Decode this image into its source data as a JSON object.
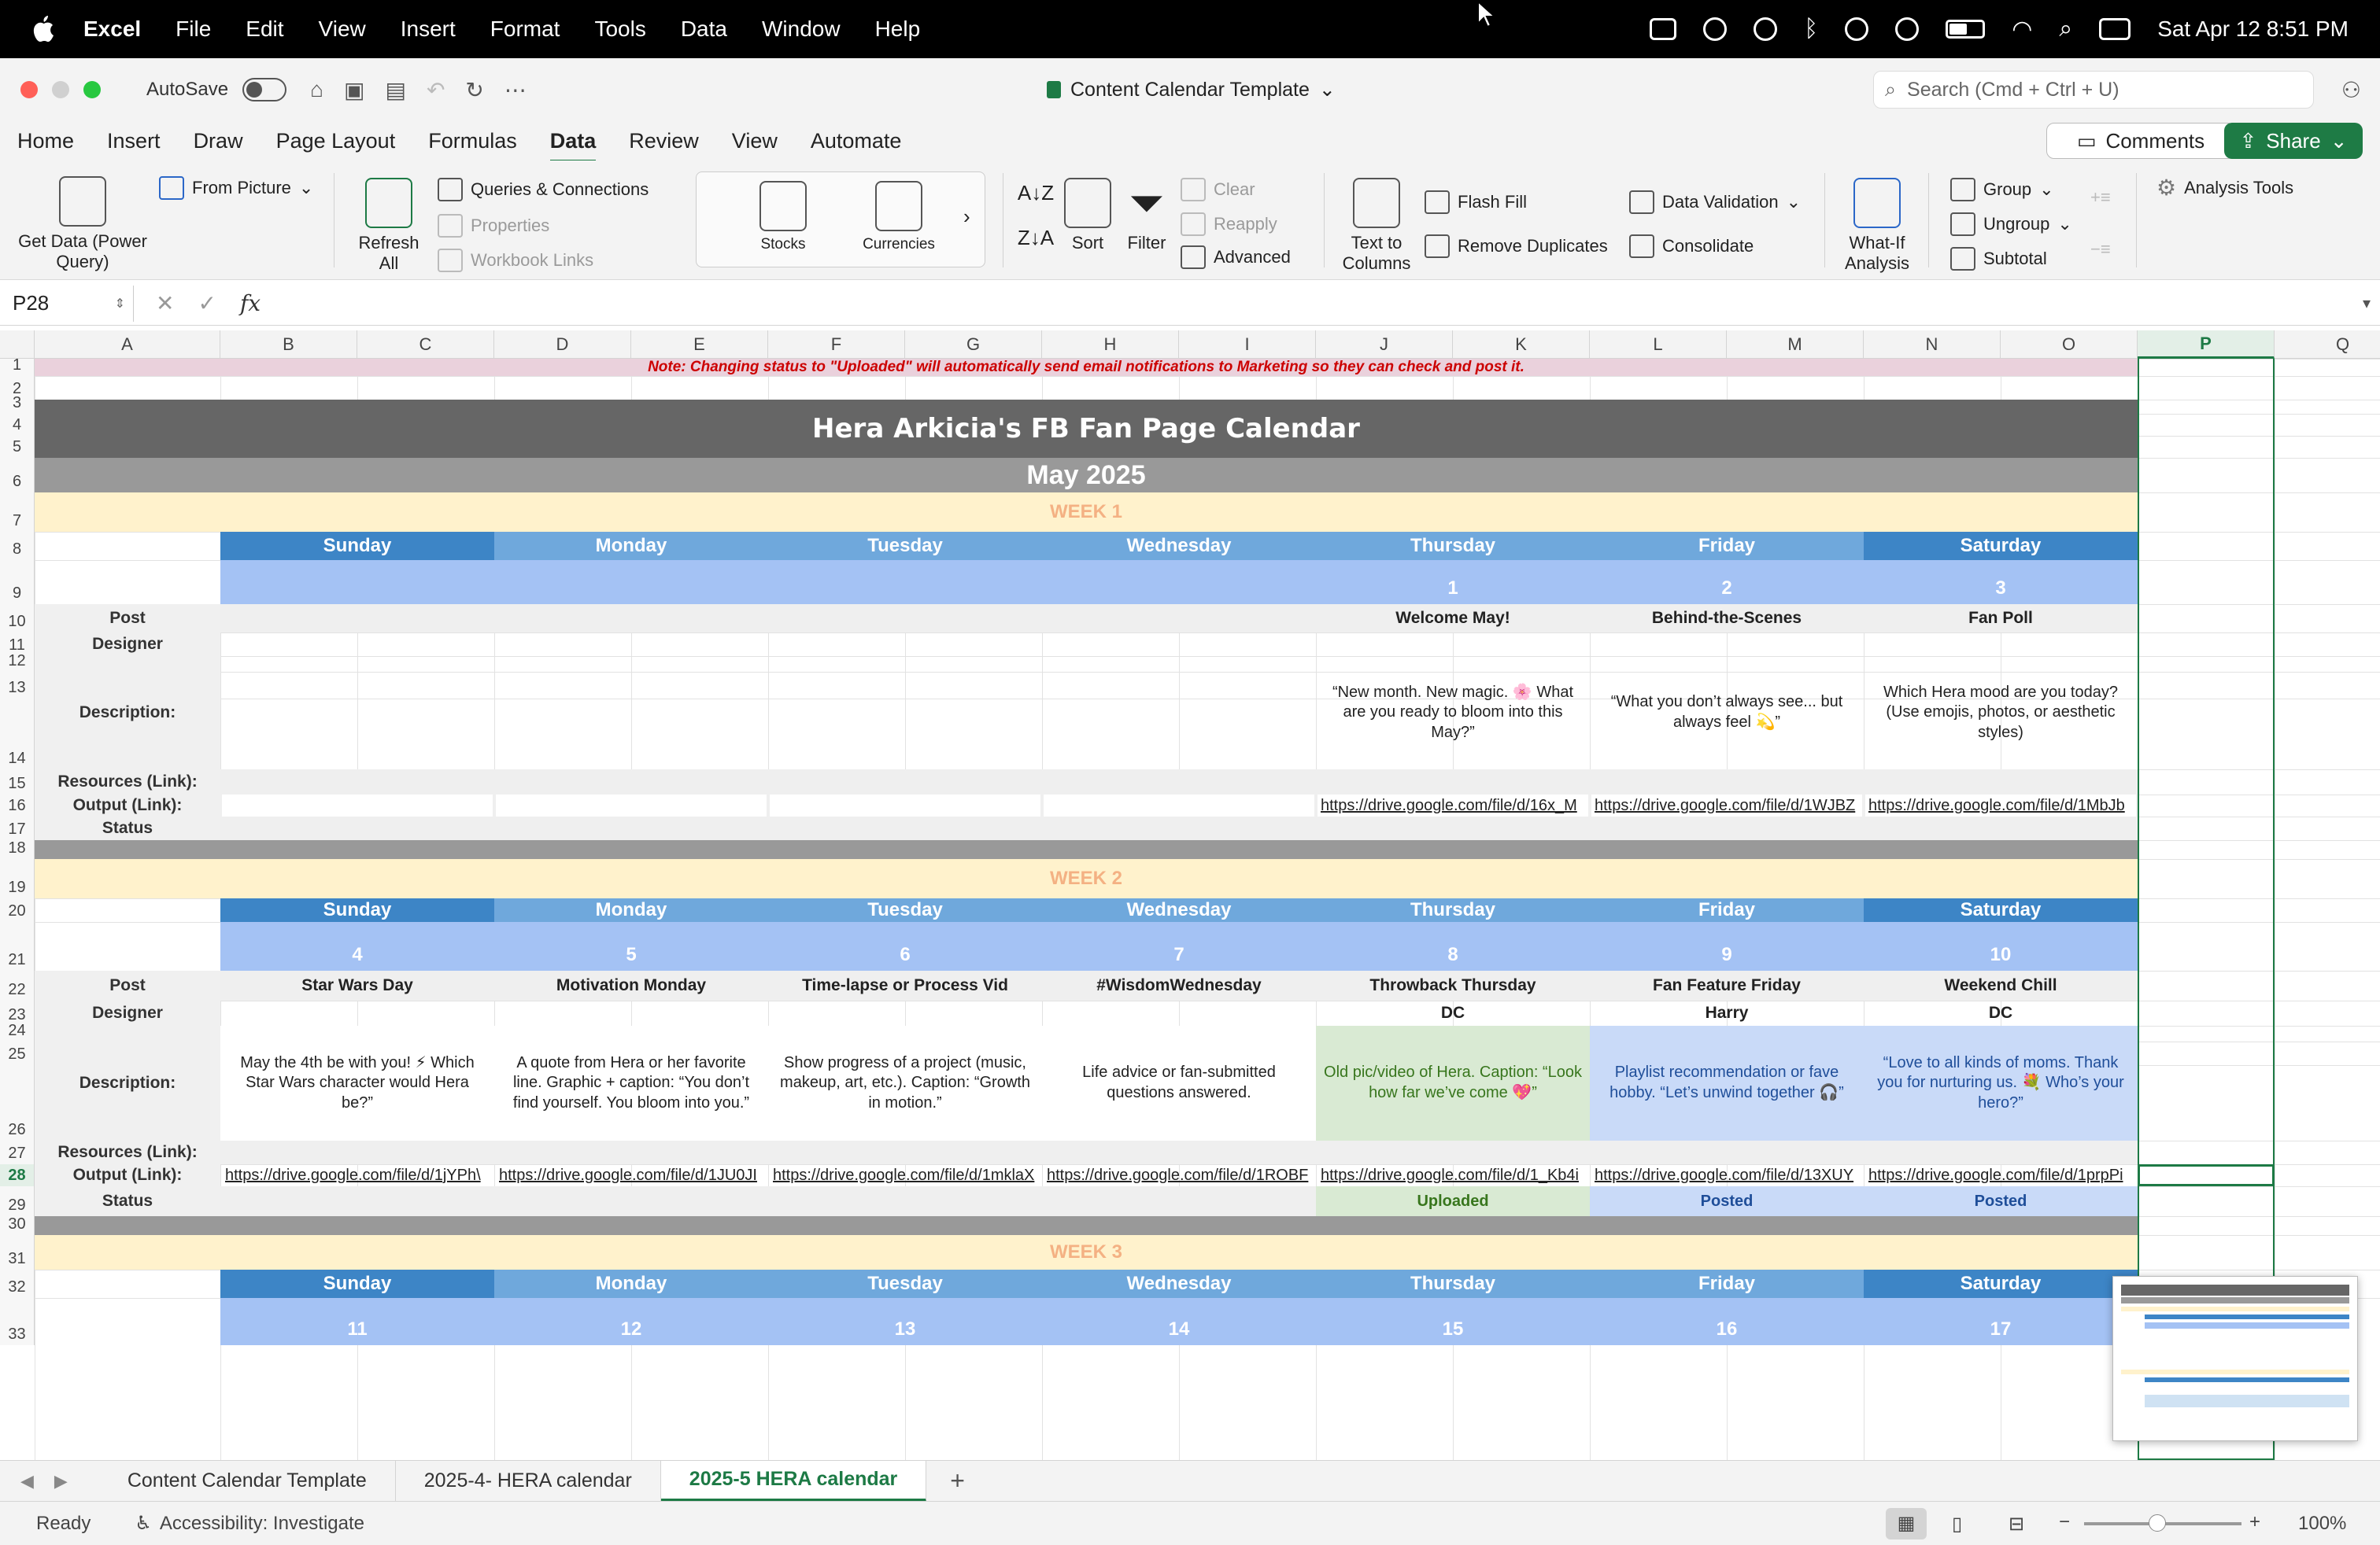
{
  "menubar": {
    "app": "Excel",
    "items": [
      "File",
      "Edit",
      "View",
      "Insert",
      "Format",
      "Tools",
      "Data",
      "Window",
      "Help"
    ],
    "clock": "Sat Apr 12  8:51 PM"
  },
  "titlebar": {
    "autosave_label": "AutoSave",
    "doc_title": "Content Calendar Template",
    "search_placeholder": "Search (Cmd + Ctrl + U)"
  },
  "ribbon_tabs": [
    "Home",
    "Insert",
    "Draw",
    "Page Layout",
    "Formulas",
    "Data",
    "Review",
    "View",
    "Automate"
  ],
  "ribbon_active_tab": "Data",
  "buttons": {
    "comments": "Comments",
    "share": "Share"
  },
  "ribbon": {
    "get_data": "Get Data (Power Query)",
    "from_picture": "From Picture",
    "refresh_all": "Refresh All",
    "queries": "Queries & Connections",
    "properties": "Properties",
    "workbook_links": "Workbook Links",
    "stocks": "Stocks",
    "currencies": "Currencies",
    "sort": "Sort",
    "filter": "Filter",
    "clear": "Clear",
    "reapply": "Reapply",
    "advanced": "Advanced",
    "text_to_columns": "Text to Columns",
    "flash_fill": "Flash Fill",
    "remove_duplicates": "Remove Duplicates",
    "data_validation": "Data Validation",
    "consolidate": "Consolidate",
    "what_if": "What-If Analysis",
    "group": "Group",
    "ungroup": "Ungroup",
    "subtotal": "Subtotal",
    "analysis_tools": "Analysis Tools"
  },
  "formula_bar": {
    "name_box": "P28",
    "fx": "fx",
    "formula": ""
  },
  "columns": [
    "A",
    "B",
    "C",
    "D",
    "E",
    "F",
    "G",
    "H",
    "I",
    "J",
    "K",
    "L",
    "M",
    "N",
    "O",
    "P",
    "Q"
  ],
  "selected_column": "P",
  "selected_row": "28",
  "sheet": {
    "note": "Note: Changing status to \"Uploaded\" will automatically send email notifications to Marketing so they can check and post it.",
    "title": "Hera Arkicia's FB Fan Page Calendar",
    "month": "May 2025",
    "days": [
      "Sunday",
      "Monday",
      "Tuesday",
      "Wednesday",
      "Thursday",
      "Friday",
      "Saturday"
    ],
    "labels": {
      "post": "Post",
      "designer": "Designer",
      "description": "Description:",
      "resources": "Resources (Link):",
      "output": "Output (Link):",
      "status": "Status"
    },
    "week1": {
      "label": "WEEK 1",
      "dates": [
        "",
        "",
        "",
        "",
        "1",
        "2",
        "3"
      ],
      "posts": [
        "",
        "",
        "",
        "",
        "Welcome May!",
        "Behind-the-Scenes",
        "Fan Poll"
      ],
      "designers": [
        "",
        "",
        "",
        "",
        "",
        "",
        ""
      ],
      "descriptions": [
        "",
        "",
        "",
        "",
        "“New month. New magic. 🌸 What are you ready to bloom into this May?”",
        "“What you don’t always see... but always feel 💫”",
        "Which Hera mood are you today? (Use emojis, photos, or aesthetic styles)"
      ],
      "outputs": [
        "",
        "",
        "",
        "",
        "https://drive.google.com/file/d/16x_M",
        "https://drive.google.com/file/d/1WJBZ",
        "https://drive.google.com/file/d/1MbJb"
      ],
      "statuses": [
        "",
        "",
        "",
        "",
        "",
        "",
        ""
      ]
    },
    "week2": {
      "label": "WEEK 2",
      "dates": [
        "4",
        "5",
        "6",
        "7",
        "8",
        "9",
        "10"
      ],
      "posts": [
        "Star Wars Day",
        "Motivation Monday",
        "Time-lapse or Process Vid",
        "#WisdomWednesday",
        "Throwback Thursday",
        "Fan Feature Friday",
        "Weekend Chill"
      ],
      "designers": [
        "",
        "",
        "",
        "",
        "DC",
        "Harry",
        "DC"
      ],
      "descriptions": [
        "May the 4th be with you! ⚡ Which Star Wars character would Hera be?”",
        "A quote from Hera or her favorite line. Graphic + caption: “You don’t find yourself. You bloom into you.”",
        "Show progress of a project (music, makeup, art, etc.). Caption: “Growth in motion.”",
        "Life advice or fan-submitted questions answered.",
        "Old pic/video of Hera. Caption: “Look how far we’ve come 💖”",
        "Playlist recommendation or fave hobby. “Let’s unwind together 🎧”",
        "“Love to all kinds of moms. Thank you for nurturing us. 💐 Who’s your hero?”"
      ],
      "outputs": [
        "https://drive.google.com/file/d/1jYPh\\",
        "https://drive.google.com/file/d/1JU0JI",
        "https://drive.google.com/file/d/1mklaX",
        "https://drive.google.com/file/d/1ROBF",
        "https://drive.google.com/file/d/1_Kb4i",
        "https://drive.google.com/file/d/13XUY",
        "https://drive.google.com/file/d/1prpPi"
      ],
      "statuses": [
        "",
        "",
        "",
        "",
        "Uploaded",
        "Posted",
        "Posted"
      ]
    },
    "week3": {
      "label": "WEEK 3",
      "dates": [
        "11",
        "12",
        "13",
        "14",
        "15",
        "16",
        "17"
      ]
    }
  },
  "sheet_tabs": [
    "Content Calendar Template",
    "2025-4- HERA calendar",
    "2025-5 HERA calendar"
  ],
  "active_sheet_tab": "2025-5 HERA calendar",
  "statusbar": {
    "ready": "Ready",
    "accessibility": "Accessibility: Investigate",
    "zoom": "100%"
  },
  "colors": {
    "accent_green": "#1d7a45",
    "title_band": "#666666",
    "month_band": "#999999",
    "week_band": "#fff2cc",
    "week_text": "#f4b183",
    "day_dark": "#3d85c6",
    "day_light": "#6fa8dc",
    "date_row": "#a4c2f4",
    "note_band": "#ead1dc",
    "note_text": "#cc0000"
  }
}
